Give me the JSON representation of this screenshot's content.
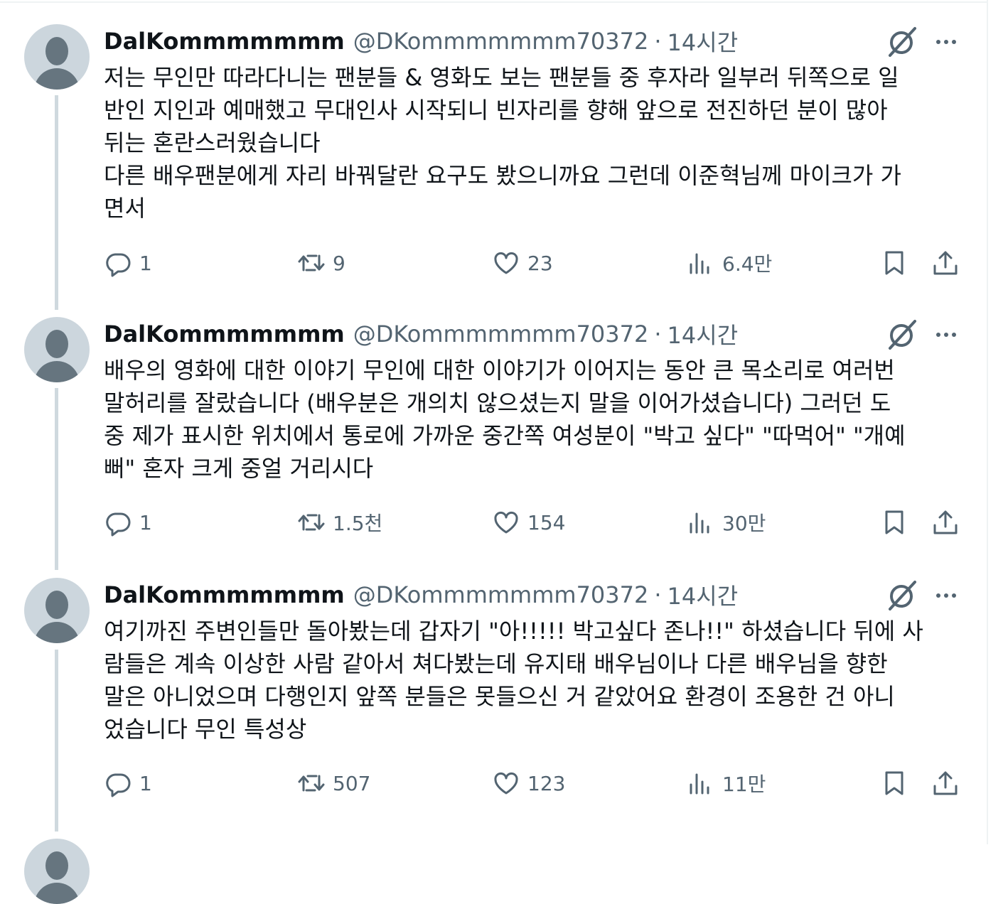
{
  "tweets": [
    {
      "display_name": "DalKommmmmmm",
      "handle": "@DKommmmmmm70372",
      "separator": "·",
      "time": "14시간",
      "lines": [
        "저는 무인만 따라다니는 팬분들 & 영화도 보는 팬분들 중 후자라 일부러 뒤쪽으로 일",
        "반인 지인과 예매했고 무대인사 시작되니 빈자리를 향해 앞으로 전진하던 분이 많아",
        "뒤는 혼란스러웠습니다",
        "다른 배우팬분에게 자리 바꿔달란 요구도 봤으니까요 그런데 이준혁님께 마이크가 가",
        "면서"
      ],
      "replies": "1",
      "retweets": "9",
      "likes": "23",
      "views": "6.4만"
    },
    {
      "display_name": "DalKommmmmmm",
      "handle": "@DKommmmmmm70372",
      "separator": "·",
      "time": "14시간",
      "lines": [
        "배우의 영화에 대한 이야기 무인에 대한 이야기가 이어지는 동안 큰 목소리로 여러번",
        "말허리를 잘랐습니다 (배우분은 개의치 않으셨는지 말을 이어가셨습니다) 그러던 도",
        "중 제가 표시한 위치에서 통로에 가까운 중간쪽 여성분이 \"박고 싶다\" \"따먹어\" \"개예",
        "뻐\" 혼자 크게 중얼 거리시다"
      ],
      "replies": "1",
      "retweets": "1.5천",
      "likes": "154",
      "views": "30만"
    },
    {
      "display_name": "DalKommmmmmm",
      "handle": "@DKommmmmmm70372",
      "separator": "·",
      "time": "14시간",
      "lines": [
        "여기까진 주변인들만 돌아봤는데 갑자기 \"아!!!!! 박고싶다 존나!!\" 하셨습니다 뒤에 사",
        "람들은 계속 이상한 사람 같아서 쳐다봤는데 유지태 배우님이나 다른 배우님을 향한",
        "말은 아니었으며 다행인지 앞쪽 분들은 못들으신 거 같았어요 환경이 조용한 건 아니",
        "었습니다 무인 특성상"
      ],
      "replies": "1",
      "retweets": "507",
      "likes": "123",
      "views": "11만"
    }
  ],
  "icons": {
    "reply": "reply-icon",
    "retweet": "retweet-icon",
    "like": "heart-icon",
    "views": "views-icon",
    "bookmark": "bookmark-icon",
    "share": "share-icon",
    "grok": "grok-icon",
    "more": "more-icon"
  },
  "colors": {
    "secondary_text": "#536471",
    "thread_line": "#cfd9de",
    "avatar_bg": "#ccd6dd"
  }
}
